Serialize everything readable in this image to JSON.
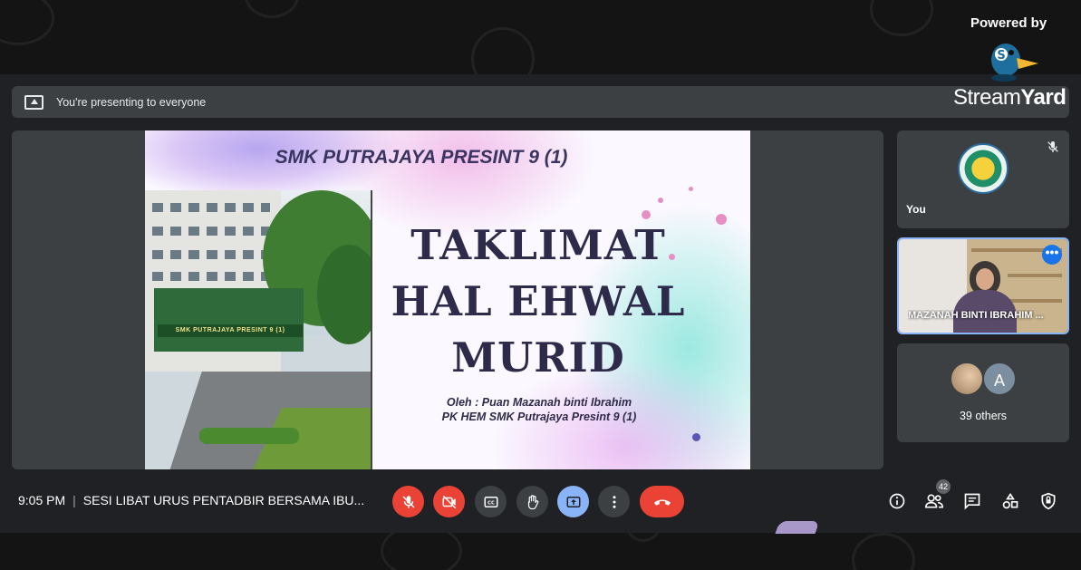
{
  "presenting_bar": {
    "text": "You're presenting to everyone"
  },
  "slide": {
    "header": "SMK PUTRAJAYA PRESINT 9 (1)",
    "title_lines": [
      "TAKLIMAT",
      "HAL EHWAL",
      "MURID"
    ],
    "subtitle_line1": "Oleh : Puan Mazanah binti Ibrahim",
    "subtitle_line2": "PK HEM SMK Putrajaya Presint 9 (1)",
    "photo_sign": "SMK PUTRAJAYA PRESINT 9 (1)"
  },
  "participants": {
    "you_label": "You",
    "speaker_name": "MAZANAH BINTI IBRAHIM ...",
    "others_avatar_letter": "A",
    "others_label": "39 others"
  },
  "meeting": {
    "time": "9:05 PM",
    "title": "SESI LIBAT URUS PENTADBIR BERSAMA IBU..."
  },
  "toolbar": {
    "participant_count": "42"
  },
  "branding": {
    "powered_by": "Powered by",
    "name_part1": "Stream",
    "name_part2": "Yard"
  },
  "colors": {
    "accent_red": "#ea4335",
    "accent_blue": "#8ab4f8",
    "tile_bg": "#3c4043",
    "stage_bg": "#202124"
  },
  "icons": [
    "present-screen-icon",
    "mic-off-icon",
    "camera-off-icon",
    "captions-icon",
    "raise-hand-icon",
    "present-now-icon",
    "more-options-icon",
    "end-call-icon",
    "info-icon",
    "people-icon",
    "chat-icon",
    "activities-icon",
    "host-controls-icon"
  ]
}
